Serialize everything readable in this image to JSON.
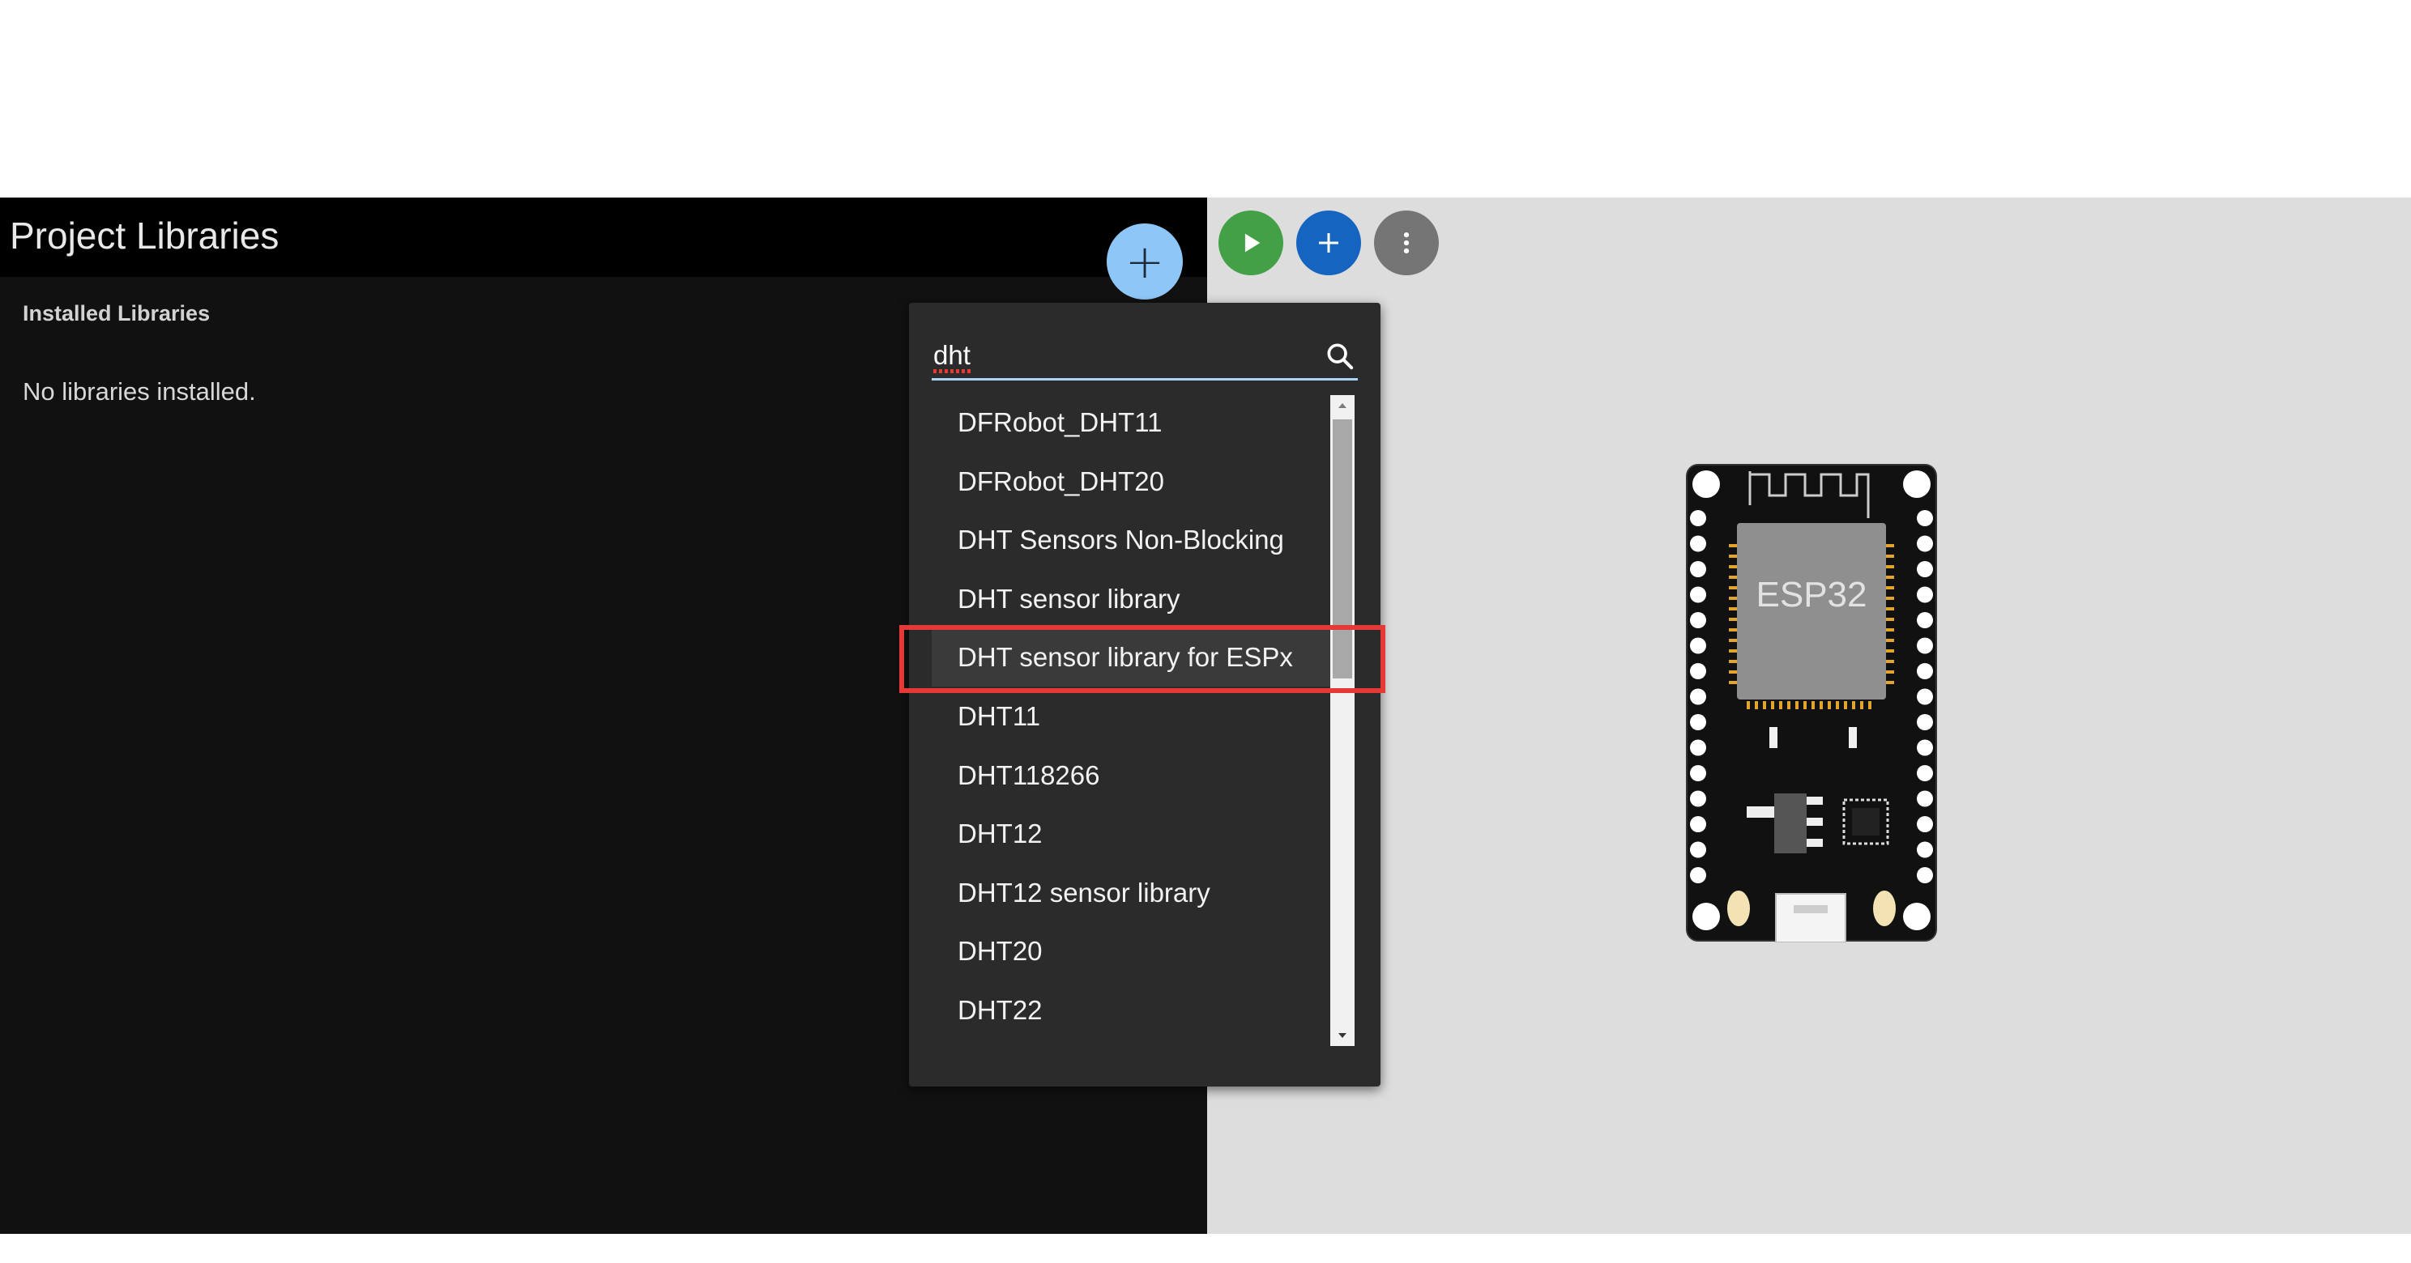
{
  "left_panel": {
    "title": "Project Libraries",
    "section_label": "Installed Libraries",
    "empty_message": "No libraries installed.",
    "add_button_icon": "plus-icon"
  },
  "toolbar": {
    "buttons": [
      {
        "name": "start-simulation",
        "icon": "play-icon",
        "color": "#43a047"
      },
      {
        "name": "add-part",
        "icon": "plus-icon",
        "color": "#1565c0"
      },
      {
        "name": "more-options",
        "icon": "more-vert-icon",
        "color": "#757575"
      }
    ]
  },
  "library_search": {
    "query": "dht",
    "icon": "search-icon",
    "results": [
      "DFRobot_DHT11",
      "DFRobot_DHT20",
      "DHT Sensors Non-Blocking",
      "DHT sensor library",
      "DHT sensor library for ESPx",
      "DHT11",
      "DHT118266",
      "DHT12",
      "DHT12 sensor library",
      "DHT20",
      "DHT22"
    ],
    "highlighted_index": 4,
    "highlight_color": "#e53935"
  },
  "board": {
    "chip_label": "ESP32"
  },
  "colors": {
    "left_panel_bg": "#111111",
    "header_bg": "#000000",
    "sim_bg": "#dddddd",
    "dropdown_bg": "#2b2b2b",
    "accent_light_blue": "#8ec7f7"
  }
}
